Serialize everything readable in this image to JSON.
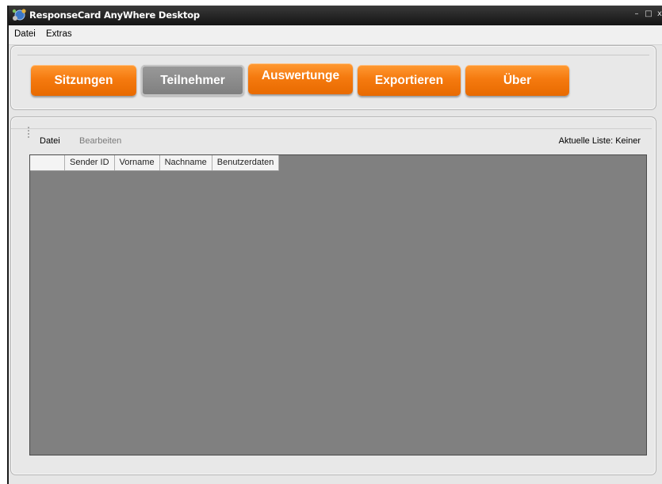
{
  "window": {
    "title": "ResponseCard AnyWhere Desktop",
    "controls": {
      "minimize": "–",
      "maximize": "□",
      "close": "x"
    }
  },
  "menubar": {
    "items": [
      {
        "label": "Datei"
      },
      {
        "label": "Extras"
      }
    ]
  },
  "nav": {
    "buttons": [
      {
        "label": "Sitzungen",
        "active": false
      },
      {
        "label": "Teilnehmer",
        "active": true
      },
      {
        "label": "Auswertunge",
        "active": false
      },
      {
        "label": "Exportieren",
        "active": false
      },
      {
        "label": "Über",
        "active": false
      }
    ]
  },
  "participants": {
    "submenu": {
      "file": "Datei",
      "edit": "Bearbeiten"
    },
    "current_list": "Aktuelle Liste: Keiner",
    "columns": [
      "Sender ID",
      "Vorname",
      "Nachname",
      "Benutzerdaten"
    ],
    "rows": []
  },
  "colors": {
    "accent": "#f57a0f",
    "active_button": "#8a8a8a",
    "grid_background": "#808080"
  },
  "icons": {
    "app": "network-globe-icon"
  }
}
